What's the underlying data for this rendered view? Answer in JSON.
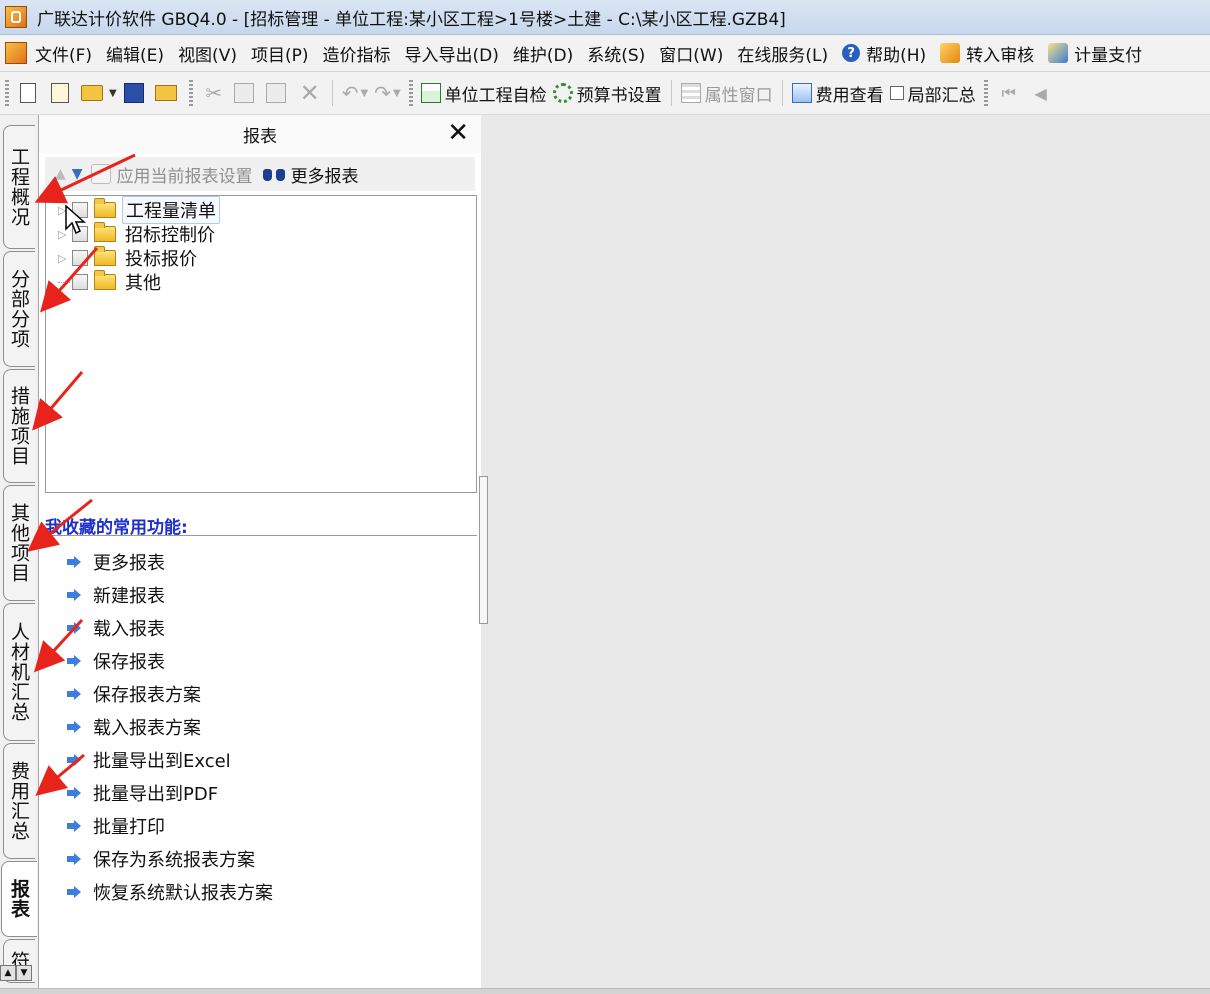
{
  "window": {
    "title": "广联达计价软件 GBQ4.0 - [招标管理 - 单位工程:某小区工程>1号楼>土建 - C:\\某小区工程.GZB4]"
  },
  "menu": {
    "items": [
      "文件(F)",
      "编辑(E)",
      "视图(V)",
      "项目(P)",
      "造价指标",
      "导入导出(D)",
      "维护(D)",
      "系统(S)",
      "窗口(W)",
      "在线服务(L)"
    ],
    "help": "帮助(H)",
    "audit": "转入审核",
    "payment": "计量支付"
  },
  "toolbar": {
    "self_check": "单位工程自检",
    "budget_settings": "预算书设置",
    "property_window": "属性窗口",
    "fee_view": "费用查看",
    "partial_summary": "局部汇总"
  },
  "vertical_tabs": [
    "工程概况",
    "分部分项",
    "措施项目",
    "其他项目",
    "人材机汇总",
    "费用汇总",
    "报表",
    "符"
  ],
  "active_tab": "报表",
  "panel": {
    "title": "报表",
    "close": "✕",
    "apply_settings": "应用当前报表设置",
    "more_reports": "更多报表"
  },
  "tree": [
    {
      "label": "工程量清单",
      "selected": true
    },
    {
      "label": "招标控制价",
      "selected": false
    },
    {
      "label": "投标报价",
      "selected": false
    },
    {
      "label": "其他",
      "selected": false
    }
  ],
  "favorites": {
    "title": "我收藏的常用功能:",
    "items": [
      "更多报表",
      "新建报表",
      "载入报表",
      "保存报表",
      "保存报表方案",
      "载入报表方案",
      "批量导出到Excel",
      "批量导出到PDF",
      "批量打印",
      "保存为系统报表方案",
      "恢复系统默认报表方案"
    ]
  },
  "colors": {
    "annotation_arrow": "#e8231b",
    "favorites_title": "#1d2fcc",
    "title_bar": "#c7d7ec"
  }
}
